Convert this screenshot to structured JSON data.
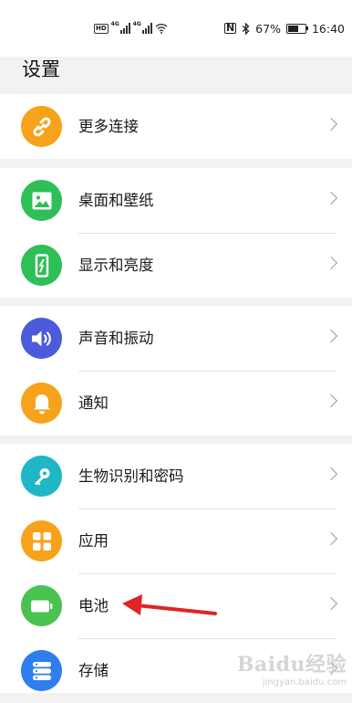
{
  "status_bar": {
    "network_tags": [
      "4G",
      "4G"
    ],
    "hd_label": "HD",
    "nfc_label": "N",
    "battery_percent": "67%",
    "battery_level": 0.67,
    "time": "16:40"
  },
  "page": {
    "title": "设置"
  },
  "groups": [
    {
      "items": [
        {
          "label": "更多连接",
          "icon": "link-icon",
          "color": "#f7a21b"
        }
      ]
    },
    {
      "items": [
        {
          "label": "桌面和壁纸",
          "icon": "image-icon",
          "color": "#2fbf57"
        },
        {
          "label": "显示和亮度",
          "icon": "phone-brightness-icon",
          "color": "#2fbf57"
        }
      ]
    },
    {
      "items": [
        {
          "label": "声音和振动",
          "icon": "speaker-icon",
          "color": "#4b5bdc"
        },
        {
          "label": "通知",
          "icon": "bell-icon",
          "color": "#f7a21b"
        }
      ]
    },
    {
      "items": [
        {
          "label": "生物识别和密码",
          "icon": "key-icon",
          "color": "#1fb7c6"
        },
        {
          "label": "应用",
          "icon": "apps-grid-icon",
          "color": "#f7a21b"
        },
        {
          "label": "电池",
          "icon": "battery-icon",
          "color": "#49c24f"
        },
        {
          "label": "存储",
          "icon": "storage-icon",
          "color": "#2f7ef0"
        }
      ]
    }
  ],
  "annotation": {
    "color": "#e02424"
  },
  "watermark": {
    "main": "Baidu经验",
    "sub": "jingyan.baidu.com"
  }
}
